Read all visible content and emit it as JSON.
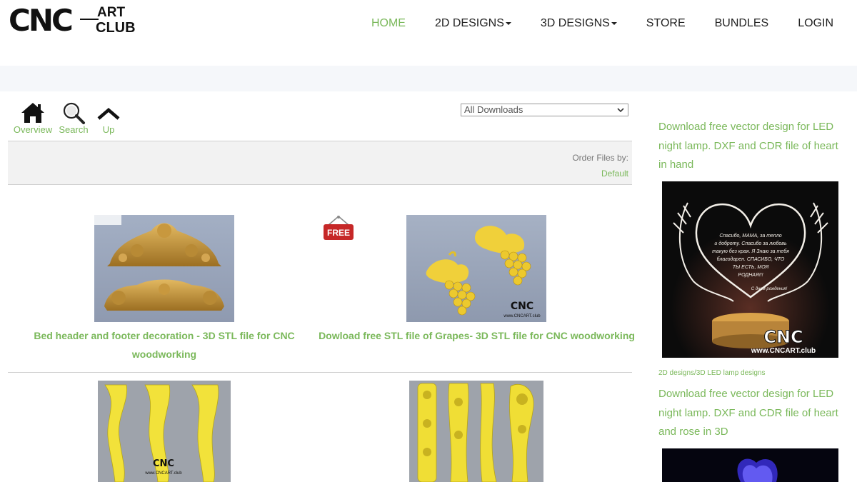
{
  "header": {
    "logo": {
      "cnc": "CNC",
      "art": "ART",
      "club": "CLUB"
    },
    "nav": [
      {
        "label": "HOME",
        "active": true,
        "dropdown": false
      },
      {
        "label": "2D DESIGNS",
        "active": false,
        "dropdown": true
      },
      {
        "label": "3D DESIGNS",
        "active": false,
        "dropdown": true
      },
      {
        "label": "STORE",
        "active": false,
        "dropdown": false
      },
      {
        "label": "BUNDLES",
        "active": false,
        "dropdown": false
      },
      {
        "label": "LOGIN",
        "active": false,
        "dropdown": false
      }
    ]
  },
  "toolbar": {
    "overview": "Overview",
    "search": "Search",
    "up": "Up"
  },
  "filter": {
    "selected": "All Downloads"
  },
  "order": {
    "label": "Order Files by:",
    "value": "Default"
  },
  "products": [
    {
      "title_line1": "Bed header and footer decoration - 3D STL file for CNC",
      "title_line2": "woodworking",
      "free": false
    },
    {
      "title_line1": "Dowload free STL file of Grapes- 3D STL file for CNC woodworking",
      "title_line2": "",
      "free": true,
      "badge": "FREE"
    },
    {
      "title_line1": "",
      "title_line2": "",
      "free": false
    },
    {
      "title_line1": "",
      "title_line2": "",
      "free": false
    }
  ],
  "watermark": {
    "cnc": "CNC",
    "art": "ART",
    "club": "CLUB",
    "url": "www.CNCART.club"
  },
  "lamp_text": [
    "Спасибо, МАМА, за тепло",
    "и доброту. Спасибо за любовь",
    "такую без края. Я Знаю за тебя",
    "благодарен. СПАСИБО, ЧТО",
    "ТЫ ЕСТЬ, МОЯ",
    "РОДНАЯ!!!"
  ],
  "lamp_sign": "С днем рождения!",
  "sidebar": {
    "items": [
      {
        "line1": "Download free vector design for LED",
        "line2": "night lamp. DXF and CDR file of heart",
        "line3": "in hand",
        "category": ""
      },
      {
        "line1": "Download free vector design for LED",
        "line2": "night lamp. DXF and CDR file of heart",
        "line3": "and rose in 3D",
        "category": "2D designs/3D LED lamp designs"
      }
    ]
  },
  "colors": {
    "accent": "#7ab85a",
    "text": "#222222",
    "band": "#f5f7fa",
    "order_bg": "#f2f2f2"
  }
}
